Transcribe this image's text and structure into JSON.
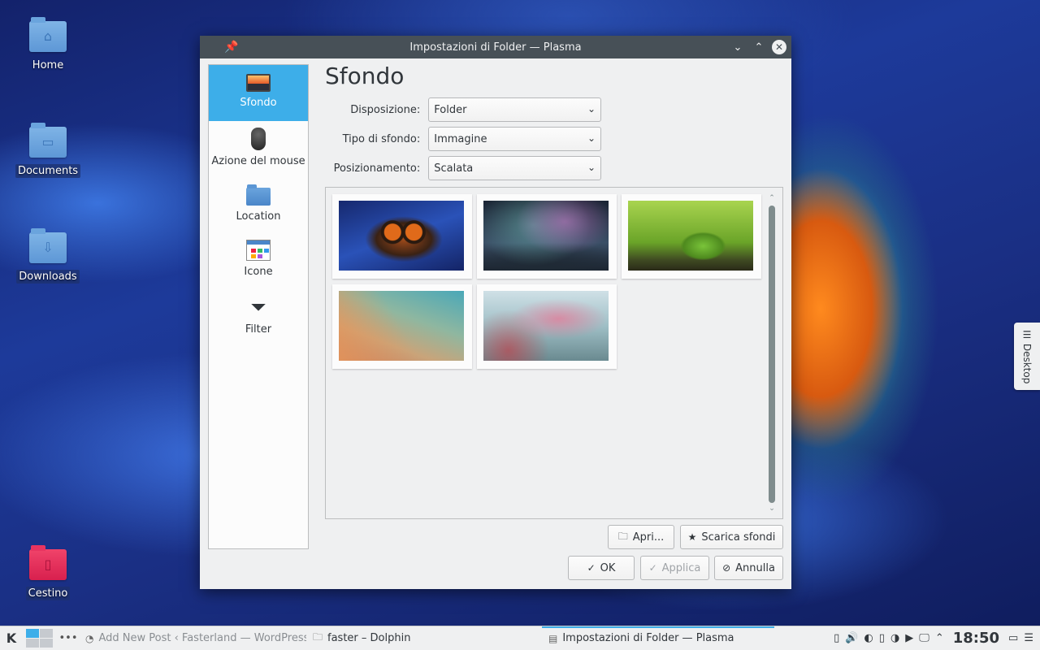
{
  "desktop": {
    "icons": [
      {
        "label": "Home",
        "glyph": "⌂"
      },
      {
        "label": "Documents",
        "glyph": "▭"
      },
      {
        "label": "Downloads",
        "glyph": "⇩"
      },
      {
        "label": "Cestino",
        "glyph": "▯"
      }
    ],
    "side_tab_label": "Desktop",
    "side_tab_icon": "☰"
  },
  "dialog": {
    "title": "Impostazioni di Folder — Plasma",
    "titlebar_icons": {
      "pin": "📌",
      "minimize": "⌄",
      "maximize": "⌃",
      "close": "✕"
    },
    "sidebar": [
      {
        "label": "Sfondo",
        "icon": "wallpaper-icon"
      },
      {
        "label": "Azione del mouse",
        "icon": "mouse-icon"
      },
      {
        "label": "Location",
        "icon": "folder-icon"
      },
      {
        "label": "Icone",
        "icon": "icons-icon"
      },
      {
        "label": "Filter",
        "icon": "filter-icon"
      }
    ],
    "page_title": "Sfondo",
    "form": {
      "layout_label": "Disposizione:",
      "layout_value": "Folder",
      "wallpaper_type_label": "Tipo di sfondo:",
      "wallpaper_type_value": "Immagine",
      "positioning_label": "Posizionamento:",
      "positioning_value": "Scalata",
      "chevron": "⌄"
    },
    "wallpapers": [
      "Owl",
      "Aurora",
      "Leaf",
      "Geometric",
      "Grass"
    ],
    "buttons": {
      "open": "Apri...",
      "open_icon": "🗀",
      "download": "Scarica sfondi",
      "download_icon": "★",
      "ok": "OK",
      "ok_icon": "✓",
      "apply": "Applica",
      "apply_icon": "✓",
      "cancel": "Annulla",
      "cancel_icon": "⊘"
    }
  },
  "taskbar": {
    "launcher_icon": "K",
    "overflow": "•••",
    "tasks": [
      {
        "label": "Add New Post ‹ Fasterland — WordPress",
        "icon": "◔"
      },
      {
        "label": "faster – Dolphin",
        "icon": "🗀"
      },
      {
        "label": "Impostazioni di Folder — Plasma",
        "icon": "▤"
      }
    ],
    "tray_icons": [
      "▯",
      "🔊",
      "◐",
      "▯",
      "◑",
      "▶",
      "🖵",
      "⌃"
    ],
    "clock": "18:50",
    "show_desktop": "▭",
    "menu": "☰"
  },
  "colors": {
    "accent": "#3daee9",
    "titlebar": "#475057",
    "window_bg": "#eff0f1"
  }
}
